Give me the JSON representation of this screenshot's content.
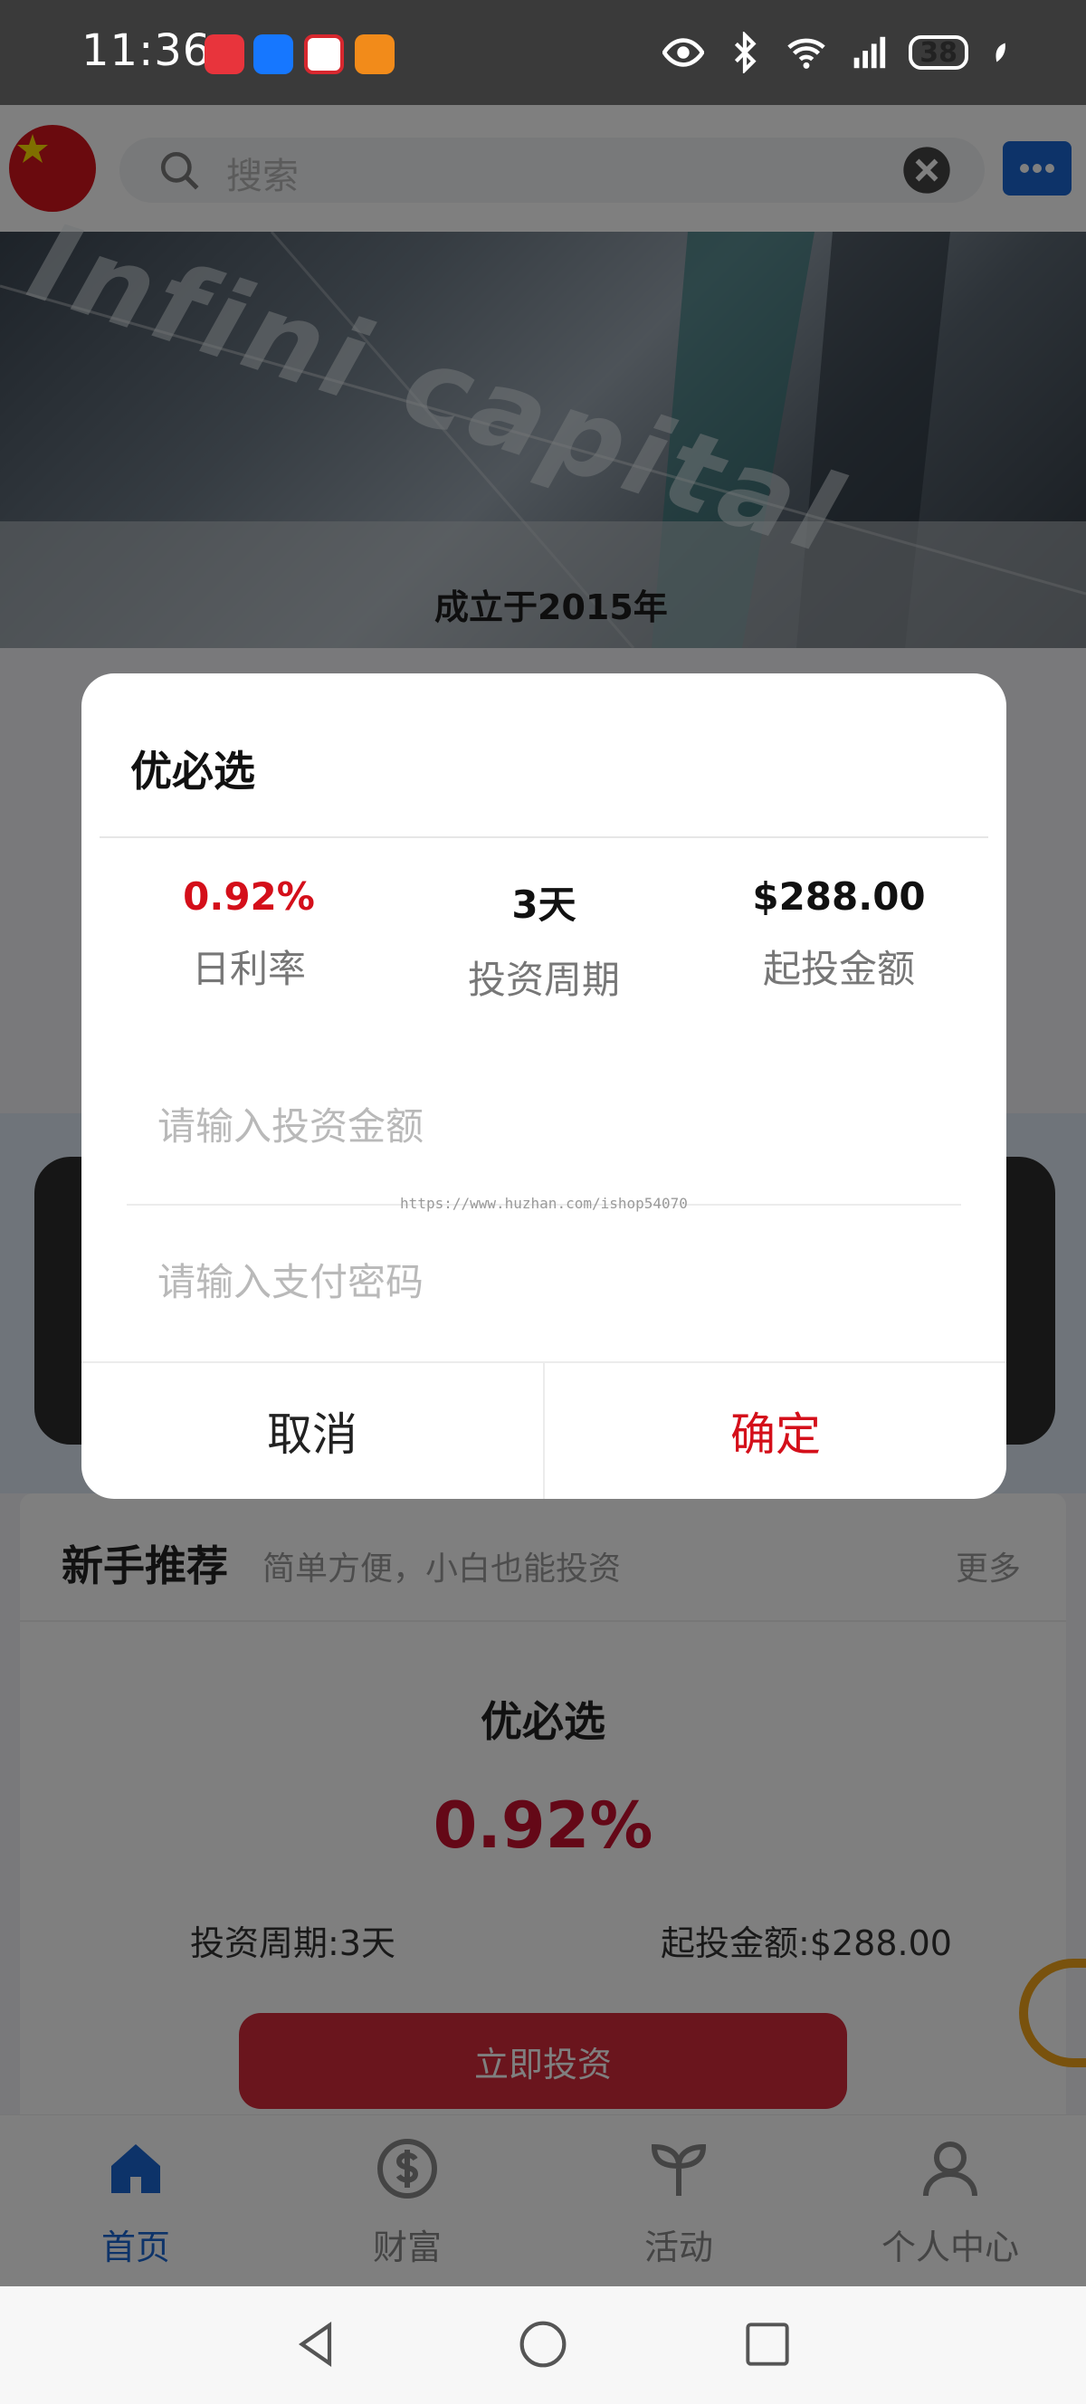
{
  "status_bar": {
    "time": "11:36",
    "battery": "38",
    "apps": [
      "huawei-app-icon",
      "alipay-icon",
      "cmb-bank-icon",
      "gift-app-icon"
    ],
    "icons": [
      "eye-icon",
      "bluetooth-icon",
      "wifi-icon",
      "4g-signal-icon",
      "battery-icon",
      "leaf-icon"
    ]
  },
  "header": {
    "search_placeholder": "搜索"
  },
  "banner": {
    "caption": "成立于2015年",
    "brand_overlay": "Infini capital"
  },
  "section": {
    "title": "新手推荐",
    "subtitle": "简单方便，小白也能投资",
    "more": "更多",
    "product": {
      "name": "优必选",
      "rate": "0.92%",
      "period": "投资周期:3天",
      "min_amount": "起投金额:$288.00",
      "invest_button": "立即投资"
    }
  },
  "bottom_nav": {
    "items": [
      {
        "label": "首页",
        "icon": "home-icon",
        "active": true
      },
      {
        "label": "财富",
        "icon": "dollar-icon",
        "active": false
      },
      {
        "label": "活动",
        "icon": "sprout-icon",
        "active": false
      },
      {
        "label": "个人中心",
        "icon": "user-icon",
        "active": false
      }
    ]
  },
  "modal": {
    "title": "优必选",
    "stats": [
      {
        "value": "0.92%",
        "label": "日利率"
      },
      {
        "value": "3天",
        "label": "投资周期"
      },
      {
        "value": "$288.00",
        "label": "起投金额"
      }
    ],
    "amount_placeholder": "请输入投资金额",
    "password_placeholder": "请输入支付密码",
    "watermark": "https://www.huzhan.com/ishop54070",
    "cancel_label": "取消",
    "confirm_label": "确定"
  },
  "colors": {
    "accent_blue": "#1a66d2",
    "accent_red": "#d40f1a"
  }
}
